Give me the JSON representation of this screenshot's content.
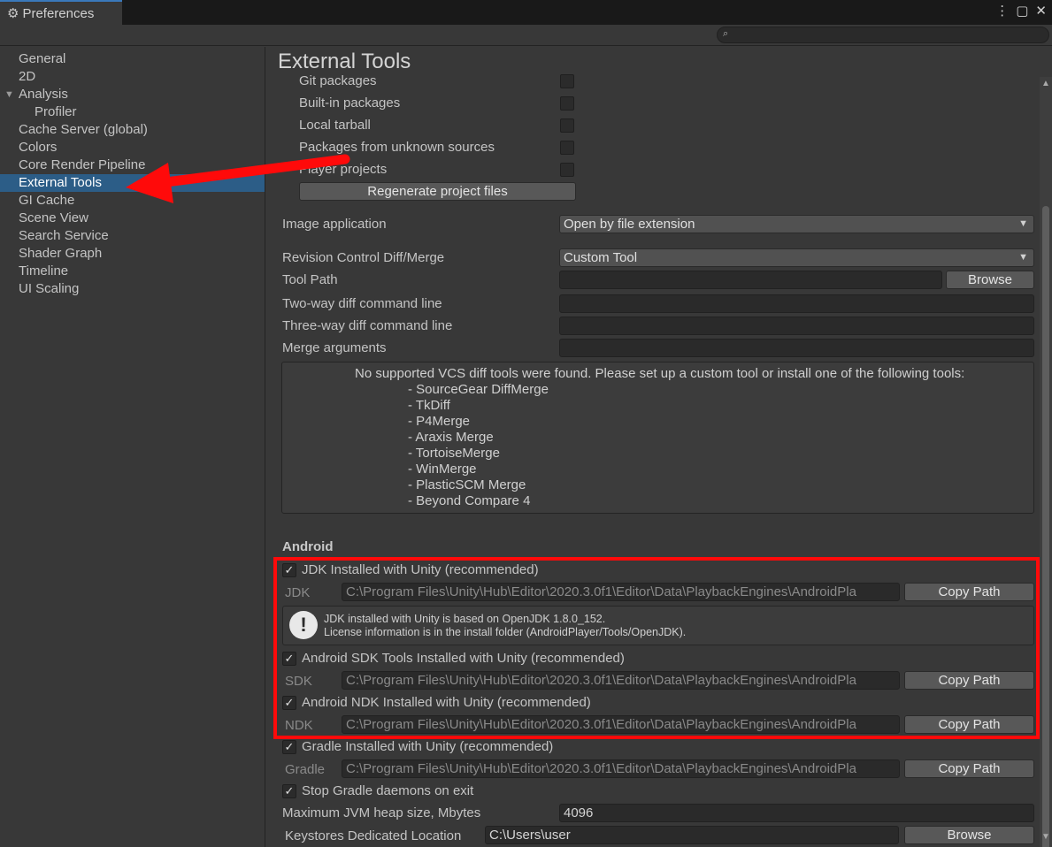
{
  "window": {
    "title": "Preferences",
    "controls": [
      "⋮",
      "▢",
      "✕"
    ],
    "search": {
      "placeholder": ""
    }
  },
  "sidebar": {
    "items": [
      {
        "label": "General"
      },
      {
        "label": "2D"
      },
      {
        "label": "Analysis",
        "expanded": true
      },
      {
        "label": "Profiler",
        "sub": true
      },
      {
        "label": "Cache Server (global)"
      },
      {
        "label": "Colors"
      },
      {
        "label": "Core Render Pipeline"
      },
      {
        "label": "External Tools",
        "active": true
      },
      {
        "label": "GI Cache"
      },
      {
        "label": "Scene View"
      },
      {
        "label": "Search Service"
      },
      {
        "label": "Shader Graph"
      },
      {
        "label": "Timeline"
      },
      {
        "label": "UI Scaling"
      }
    ]
  },
  "main": {
    "title": "External Tools",
    "packages": [
      {
        "label": "Git packages",
        "checked": false
      },
      {
        "label": "Built-in packages",
        "checked": false
      },
      {
        "label": "Local tarball",
        "checked": false
      },
      {
        "label": "Packages from unknown sources",
        "checked": false
      },
      {
        "label": "Player projects",
        "checked": false
      }
    ],
    "regenerate_label": "Regenerate project files",
    "image_app": {
      "label": "Image application",
      "value": "Open by file extension"
    },
    "diff_merge": {
      "label": "Revision Control Diff/Merge",
      "value": "Custom Tool"
    },
    "tool_path": {
      "label": "Tool Path",
      "value": "",
      "browse": "Browse"
    },
    "two_way": {
      "label": "Two-way diff command line",
      "value": ""
    },
    "three_way": {
      "label": "Three-way diff command line",
      "value": ""
    },
    "merge_args": {
      "label": "Merge arguments",
      "value": ""
    },
    "help": {
      "heading": "No supported VCS diff tools were found. Please set up a custom tool or install one of the following tools:",
      "tools": [
        "- SourceGear DiffMerge",
        "- TkDiff",
        "- P4Merge",
        "- Araxis Merge",
        "- TortoiseMerge",
        "- WinMerge",
        "- PlasticSCM Merge",
        "- Beyond Compare 4"
      ]
    },
    "android": {
      "title": "Android",
      "jdk_installed": {
        "label": "JDK Installed with Unity (recommended)",
        "checked": true
      },
      "jdk": {
        "label": "JDK",
        "path": "C:\\Program Files\\Unity\\Hub\\Editor\\2020.3.0f1\\Editor\\Data\\PlaybackEngines\\AndroidPla",
        "copy": "Copy Path"
      },
      "info_line1": "JDK installed with Unity is based on OpenJDK 1.8.0_152.",
      "info_line2": "License information is in the install folder (AndroidPlayer/Tools/OpenJDK).",
      "sdk_installed": {
        "label": "Android SDK Tools Installed with Unity (recommended)",
        "checked": true
      },
      "sdk": {
        "label": "SDK",
        "path": "C:\\Program Files\\Unity\\Hub\\Editor\\2020.3.0f1\\Editor\\Data\\PlaybackEngines\\AndroidPla",
        "copy": "Copy Path"
      },
      "ndk_installed": {
        "label": "Android NDK Installed with Unity (recommended)",
        "checked": true
      },
      "ndk": {
        "label": "NDK",
        "path": "C:\\Program Files\\Unity\\Hub\\Editor\\2020.3.0f1\\Editor\\Data\\PlaybackEngines\\AndroidPla",
        "copy": "Copy Path"
      },
      "gradle_installed": {
        "label": "Gradle Installed with Unity (recommended)",
        "checked": true
      },
      "gradle": {
        "label": "Gradle",
        "path": "C:\\Program Files\\Unity\\Hub\\Editor\\2020.3.0f1\\Editor\\Data\\PlaybackEngines\\AndroidPla",
        "copy": "Copy Path"
      },
      "stop_gradle": {
        "label": "Stop Gradle daemons on exit",
        "checked": true
      },
      "jvm_heap": {
        "label": "Maximum JVM heap size, Mbytes",
        "value": "4096"
      },
      "keystores": {
        "label": "Keystores Dedicated Location",
        "value": "C:\\Users\\user",
        "browse": "Browse"
      }
    }
  },
  "annotation": {
    "highlight_color": "#ff0a0a"
  }
}
